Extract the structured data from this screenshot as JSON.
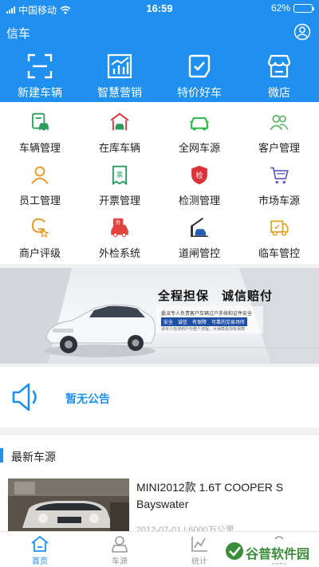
{
  "status_bar": {
    "carrier": "中国移动",
    "time": "16:59",
    "battery_text": "62%",
    "battery_level": 0.62
  },
  "header": {
    "title": "信车"
  },
  "quick_actions": [
    {
      "label": "新建车辆",
      "icon": "scan-icon"
    },
    {
      "label": "智慧营销",
      "icon": "chart-icon"
    },
    {
      "label": "特价好车",
      "icon": "tag-icon"
    },
    {
      "label": "微店",
      "icon": "shop-icon"
    }
  ],
  "grid": [
    {
      "label": "车辆管理",
      "icon": "vehicle-management-icon",
      "color": "#2a9d5c"
    },
    {
      "label": "在库车辆",
      "icon": "garage-car-icon",
      "color": "#d9343a"
    },
    {
      "label": "全网车源",
      "icon": "network-car-icon",
      "color": "#29b84a"
    },
    {
      "label": "客户管理",
      "icon": "customers-icon",
      "color": "#5fb56a"
    },
    {
      "label": "员工管理",
      "icon": "employee-icon",
      "color": "#e59a2a"
    },
    {
      "label": "开票管理",
      "icon": "invoice-icon",
      "color": "#2a9d5c"
    },
    {
      "label": "检测管理",
      "icon": "inspection-icon",
      "color": "#d9343a"
    },
    {
      "label": "市场车源",
      "icon": "market-cart-icon",
      "color": "#6a62c4"
    },
    {
      "label": "商户评级",
      "icon": "merchant-rating-icon",
      "color": "#e59a2a"
    },
    {
      "label": "外检系统",
      "icon": "external-inspection-icon",
      "color": "#e0443f"
    },
    {
      "label": "道闸管控",
      "icon": "barrier-gate-icon",
      "color": "#1f5fb5"
    },
    {
      "label": "临车管控",
      "icon": "temp-car-icon",
      "color": "#e0a52a"
    }
  ],
  "banner": {
    "title": "全程担保　诚信赔付",
    "line1": "委派专人负责客户车辆过户手续和证件安全",
    "line2": "安全　诚信　有保障　可靠的交易场所",
    "line3": "请专人检测到户份整个流程，大保障更加有保障"
  },
  "notice": {
    "text": "暂无公告"
  },
  "latest": {
    "section_title": "最新车源",
    "car": {
      "name": "MINI2012款 1.6T COOPER S Bayswater",
      "meta": "2012-07-01 | 6000万公里"
    }
  },
  "tabs": [
    {
      "label": "首页",
      "icon": "home-icon",
      "active": true
    },
    {
      "label": "车源",
      "icon": "car-source-icon",
      "active": false
    },
    {
      "label": "统计",
      "icon": "stats-icon",
      "active": false
    },
    {
      "label": "我的",
      "icon": "profile-icon",
      "active": false
    }
  ],
  "watermark": {
    "text": "谷普软件园"
  },
  "colors": {
    "primary": "#1f8ff0"
  }
}
